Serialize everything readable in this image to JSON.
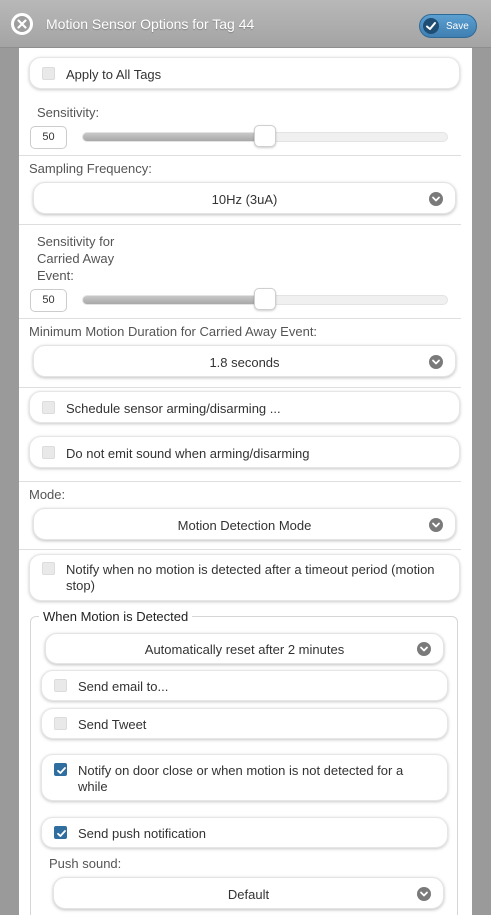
{
  "header": {
    "title": "Motion Sensor Options for Tag 44",
    "save_label": "Save"
  },
  "apply_all": {
    "label": "Apply to All Tags",
    "checked": false
  },
  "sensitivity": {
    "label": "Sensitivity:",
    "value": "50",
    "level": 0.5
  },
  "sampling": {
    "label": "Sampling Frequency:",
    "selected": "10Hz (3uA)"
  },
  "carried_sensitivity": {
    "label_lines": [
      "Sensitivity for",
      "Carried Away",
      "Event:"
    ],
    "value": "50",
    "level": 0.5
  },
  "min_duration": {
    "label": "Minimum Motion Duration for Carried Away Event:",
    "selected": "1.8 seconds"
  },
  "schedule": {
    "label": "Schedule sensor arming/disarming ...",
    "checked": false
  },
  "no_sound": {
    "label": "Do not emit sound when arming/disarming",
    "checked": false
  },
  "mode": {
    "label": "Mode:",
    "selected": "Motion Detection Mode"
  },
  "notify_timeout": {
    "label_lines": [
      "Notify when no motion is detected after a timeout period (motion",
      "stop)"
    ],
    "checked": false
  },
  "when_motion": {
    "legend": "When Motion is Detected",
    "reset_selected": "Automatically reset after 2 minutes",
    "send_email": {
      "label": "Send email to...",
      "checked": false
    },
    "send_tweet": {
      "label": "Send Tweet",
      "checked": false
    },
    "notify_door": {
      "label_lines": [
        "Notify on door close or when motion is not detected for a",
        "while"
      ],
      "checked": true
    },
    "push": {
      "label": "Send push notification",
      "checked": true
    },
    "push_sound": {
      "label": "Push sound:",
      "selected": "Default"
    }
  },
  "icons": {
    "close": "close-circle-icon",
    "save_check": "check-circle-icon",
    "dropdown": "chevron-down-icon"
  },
  "colors": {
    "accent": "#2f6e9e",
    "header_bg": "#a8a8a8",
    "save_btn": "#4a8cc0"
  }
}
